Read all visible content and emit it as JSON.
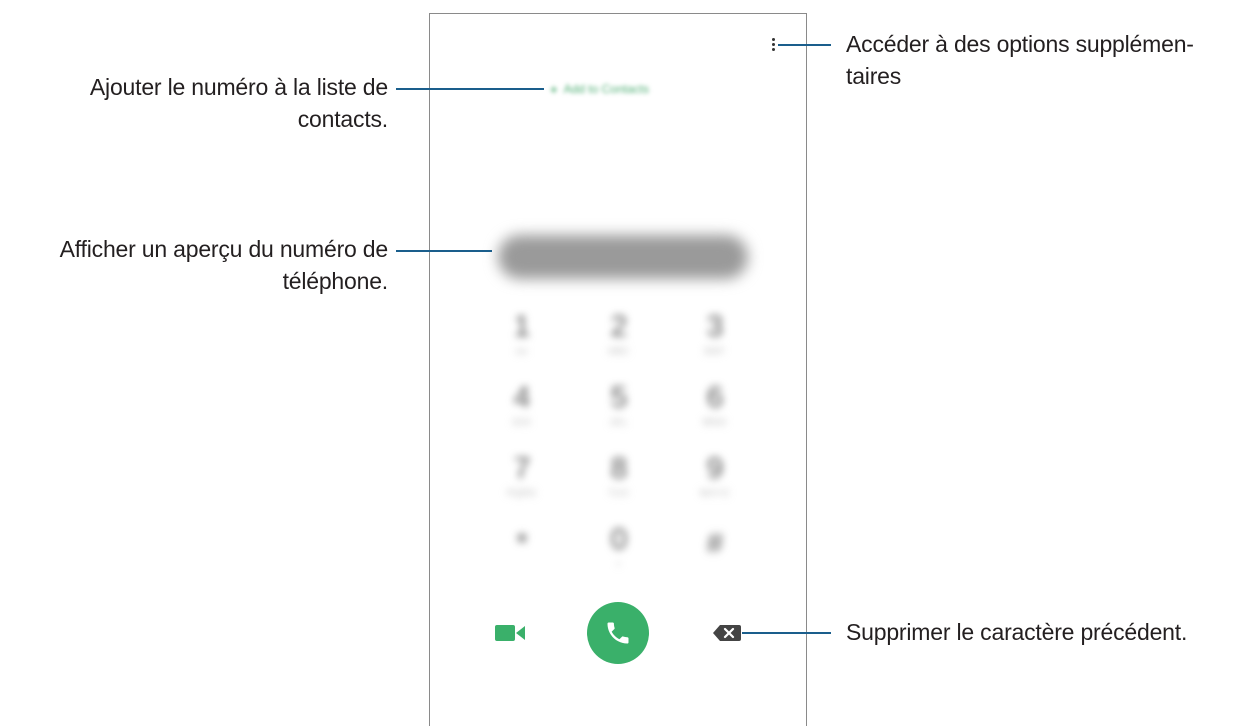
{
  "phone": {
    "add_to_contacts": "Add to Contacts",
    "add_plus": "+",
    "keys": [
      {
        "digit": "1",
        "letters": "oo"
      },
      {
        "digit": "2",
        "letters": "ABC"
      },
      {
        "digit": "3",
        "letters": "DEF"
      },
      {
        "digit": "4",
        "letters": "GHI"
      },
      {
        "digit": "5",
        "letters": "JKL"
      },
      {
        "digit": "6",
        "letters": "MNO"
      },
      {
        "digit": "7",
        "letters": "PQRS"
      },
      {
        "digit": "8",
        "letters": "TUV"
      },
      {
        "digit": "9",
        "letters": "WXYZ"
      },
      {
        "digit": "*",
        "letters": ""
      },
      {
        "digit": "0",
        "letters": "+"
      },
      {
        "digit": "#",
        "letters": ""
      }
    ],
    "call_color": "#3ab06a",
    "accent_color": "#1a5e8c"
  },
  "callouts": {
    "add_contact_line1": "Ajouter le numéro à la liste de",
    "add_contact_line2": "contacts.",
    "preview_line1": "Afficher un aperçu du numéro de",
    "preview_line2": "téléphone.",
    "options_line1": "Accéder à des options supplémen-",
    "options_line2": "taires",
    "delete": "Supprimer le caractère précédent."
  }
}
